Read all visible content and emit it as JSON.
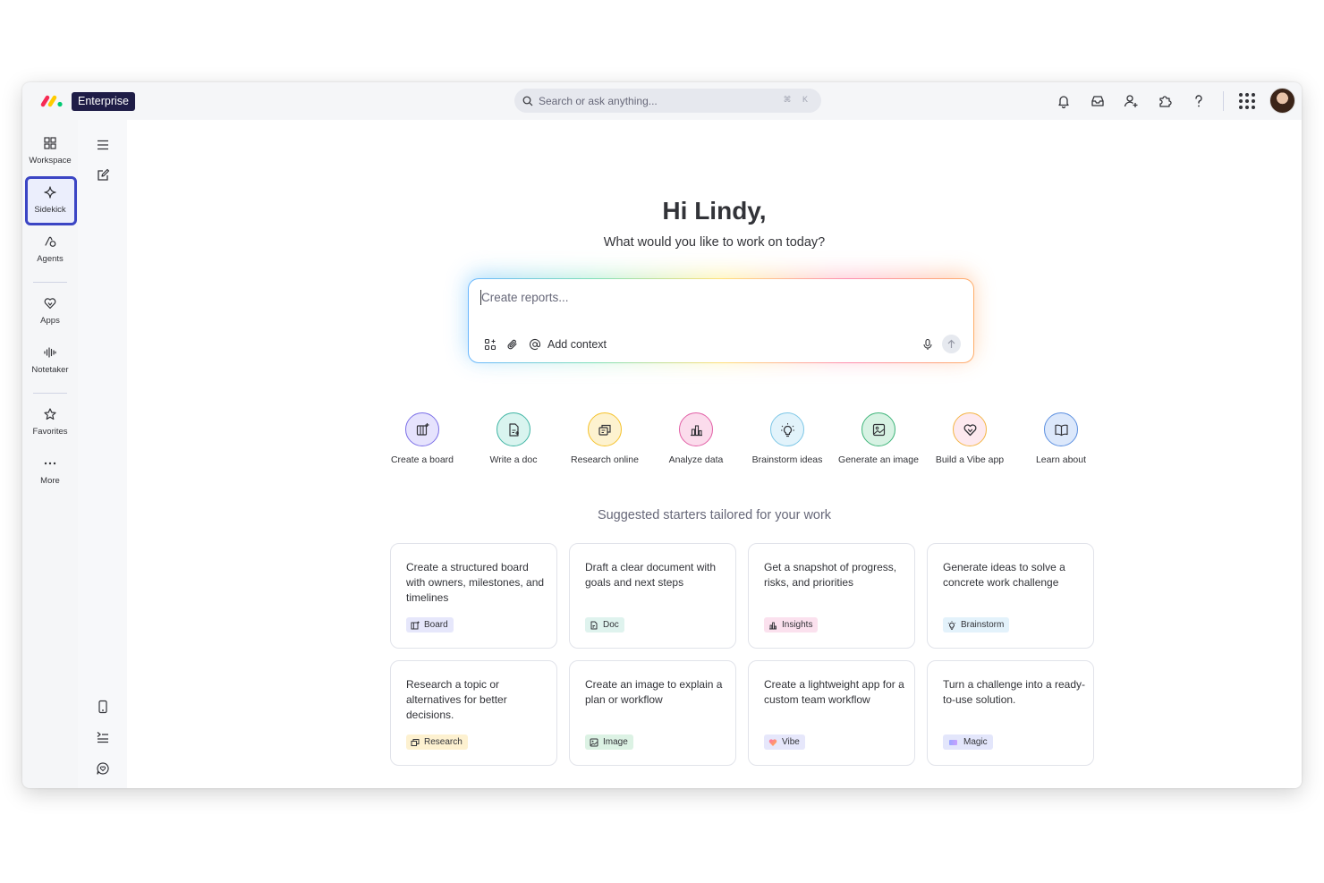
{
  "app": {
    "plan_badge": "Enterprise",
    "brand_colors": [
      "#f62b54",
      "#ffcb00",
      "#00ca72"
    ]
  },
  "search": {
    "placeholder": "Search or ask anything...",
    "shortcut": "⌘ K"
  },
  "topbar_icons": [
    "bell-icon",
    "inbox-icon",
    "invite-user-icon",
    "integrations-icon",
    "help-icon",
    "app-grid-icon",
    "avatar"
  ],
  "nav": {
    "items": [
      {
        "label": "Workspace",
        "icon": "grid-icon"
      },
      {
        "label": "Sidekick",
        "icon": "sparkle-icon",
        "selected": true
      },
      {
        "label": "Agents",
        "icon": "agents-icon"
      },
      {
        "label": "Apps",
        "icon": "heart-icon"
      },
      {
        "label": "Notetaker",
        "icon": "waveform-icon"
      },
      {
        "label": "Favorites",
        "icon": "star-icon"
      },
      {
        "label": "More",
        "icon": "more-icon"
      }
    ],
    "selected_color": "#3b45c4"
  },
  "main": {
    "greeting": "Hi Lindy,",
    "subtitle": "What would you like to work on today?",
    "prompt": {
      "placeholder": "Create reports...",
      "add_context": "Add context"
    },
    "actions": [
      {
        "label": "Create a board",
        "color": "#7b6fe8",
        "bg": "#e6e3fd",
        "icon": "board-icon"
      },
      {
        "label": "Write a doc",
        "color": "#3fb5a4",
        "bg": "#d9f4ef",
        "icon": "doc-icon"
      },
      {
        "label": "Research online",
        "color": "#f5c22c",
        "bg": "#fdf2cf",
        "icon": "research-icon"
      },
      {
        "label": "Analyze data",
        "color": "#e25fa6",
        "bg": "#fbdcec",
        "icon": "chart-icon"
      },
      {
        "label": "Brainstorm ideas",
        "color": "#7cc6e6",
        "bg": "#e2f3fb",
        "icon": "bulb-icon"
      },
      {
        "label": "Generate an image",
        "color": "#3fb57a",
        "bg": "#d7f2e3",
        "icon": "image-icon"
      },
      {
        "label": "Build a Vibe app",
        "color": "#f4b545",
        "bg": "#fde9ef",
        "icon": "vibe-heart-icon"
      },
      {
        "label": "Learn about",
        "color": "#5b8fe0",
        "bg": "#dce8fb",
        "icon": "book-icon"
      }
    ],
    "suggest_title": "Suggested starters tailored for your work",
    "cards": [
      {
        "text": "Create a structured board with owners, milestones, and timelines",
        "tag": "Board",
        "tag_bg": "#e6e7fb",
        "icon": "board-icon"
      },
      {
        "text": "Draft a clear document with goals and next steps",
        "tag": "Doc",
        "tag_bg": "#dff3ee",
        "icon": "doc-icon"
      },
      {
        "text": "Get a snapshot of progress, risks, and priorities",
        "tag": "Insights",
        "tag_bg": "#fbe1ee",
        "icon": "chart-icon"
      },
      {
        "text": "Generate ideas to solve a concrete work challenge",
        "tag": "Brainstorm",
        "tag_bg": "#e3f2fb",
        "icon": "bulb-icon"
      },
      {
        "text": "Research a topic or alternatives for better decisions.",
        "tag": "Research",
        "tag_bg": "#fdf1d0",
        "icon": "research-icon"
      },
      {
        "text": "Create an image to explain a plan or workflow",
        "tag": "Image",
        "tag_bg": "#dcf2e4",
        "icon": "image-icon"
      },
      {
        "text": "Create a lightweight app for a custom team workflow",
        "tag": "Vibe",
        "tag_bg": "#e6e7fb",
        "icon": "vibe-heart-icon"
      },
      {
        "text": "Turn a challenge into a ready-to-use solution.",
        "tag": "Magic",
        "tag_bg": "#e3e6fb",
        "icon": "magic-icon"
      }
    ]
  }
}
